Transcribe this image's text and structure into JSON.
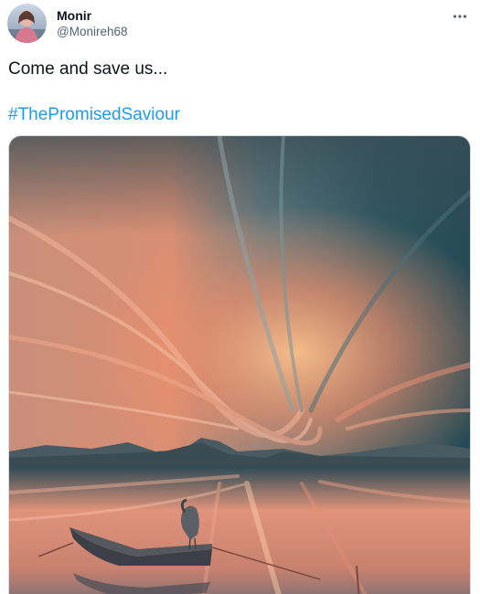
{
  "user": {
    "display_name": "Monir",
    "handle": "@Monireh68"
  },
  "tweet": {
    "text": "Come and save us...",
    "hashtag": "#ThePromisedSaviour"
  },
  "icons": {
    "more": "more-horizontal-icon"
  },
  "colors": {
    "text": "#0f1419",
    "secondary": "#536471",
    "link": "#1d9bf0"
  }
}
